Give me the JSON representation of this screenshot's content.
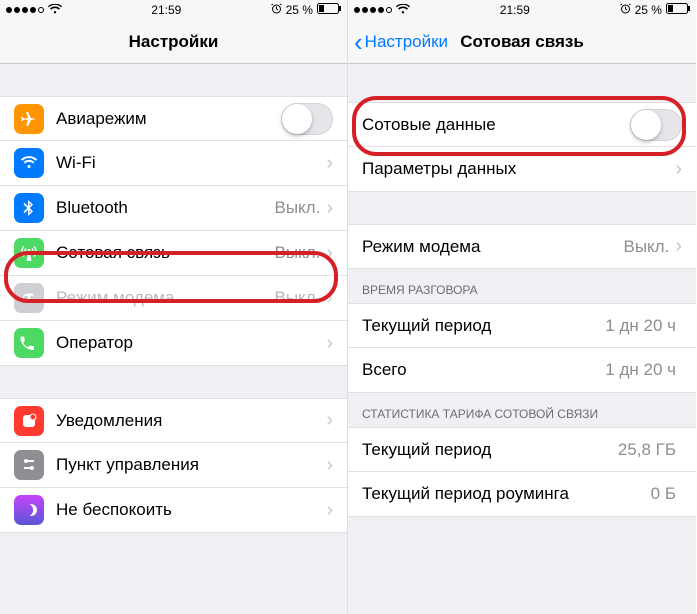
{
  "status": {
    "time": "21:59",
    "battery": "25 %"
  },
  "left": {
    "title": "Настройки",
    "rows": {
      "airplane": "Авиарежим",
      "wifi": "Wi-Fi",
      "bluetooth": "Bluetooth",
      "bluetooth_val": "Выкл.",
      "cellular": "Сотовая связь",
      "cellular_val": "Выкл.",
      "hotspot": "Режим модема",
      "hotspot_val": "Выкл.",
      "carrier": "Оператор",
      "notifications": "Уведомления",
      "control": "Пункт управления",
      "dnd": "Не беспокоить"
    }
  },
  "right": {
    "back": "Настройки",
    "title": "Сотовая связь",
    "rows": {
      "cell_data": "Сотовые данные",
      "data_options": "Параметры данных",
      "hotspot": "Режим модема",
      "hotspot_val": "Выкл.",
      "call_header": "ВРЕМЯ РАЗГОВОРА",
      "cur_period": "Текущий период",
      "cur_period_val": "1 дн 20 ч",
      "total": "Всего",
      "total_val": "1 дн 20 ч",
      "stats_header": "СТАТИСТИКА ТАРИФА СОТОВОЙ СВЯЗИ",
      "stats_cur": "Текущий период",
      "stats_cur_val": "25,8 ГБ",
      "stats_roam": "Текущий период роуминга",
      "stats_roam_val": "0 Б"
    }
  }
}
